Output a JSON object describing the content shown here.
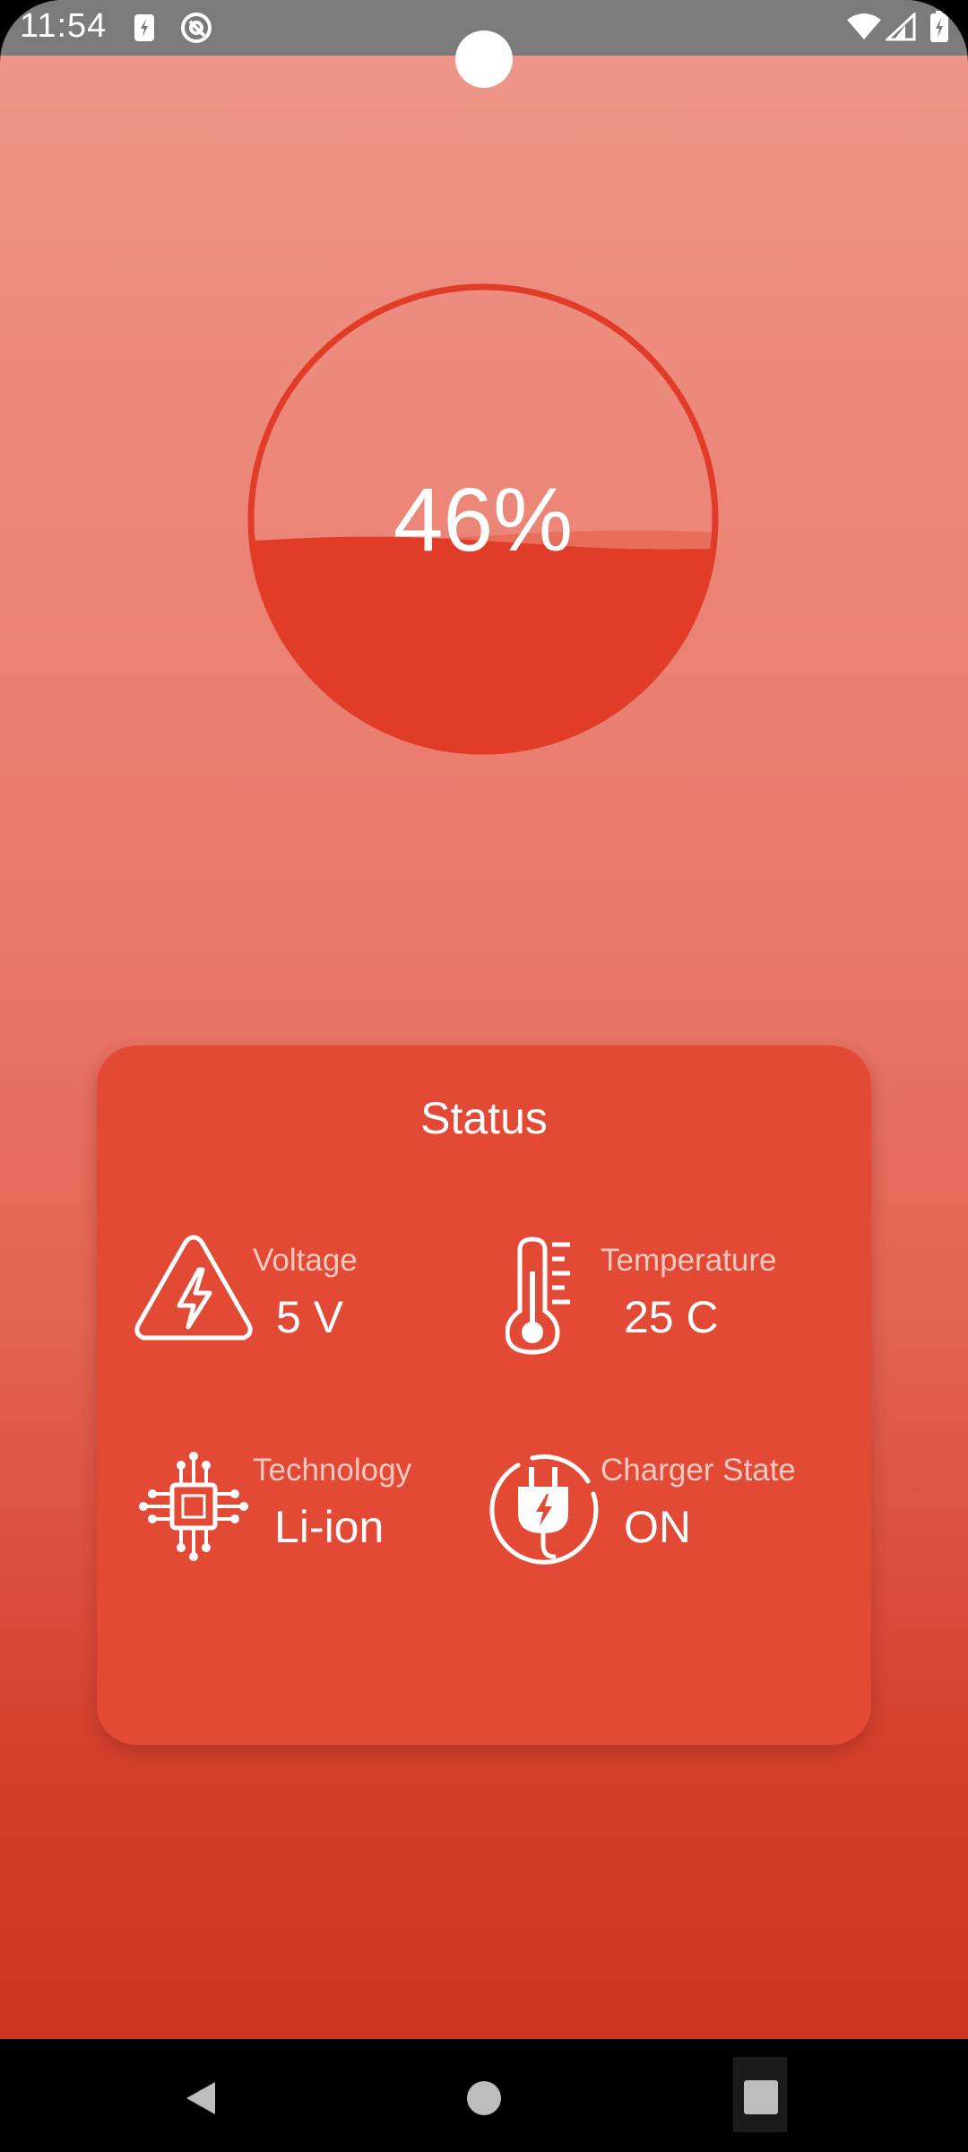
{
  "status_bar": {
    "time": "11:54"
  },
  "battery": {
    "percent_label": "46%",
    "level_fraction": 0.46,
    "fill_color": "#e03c28",
    "ring_color": "#e03c28"
  },
  "status_card": {
    "title": "Status",
    "items": [
      {
        "icon": "voltage-warning-icon",
        "label": "Voltage",
        "value": "5 V"
      },
      {
        "icon": "thermometer-icon",
        "label": "Temperature",
        "value": "25 C"
      },
      {
        "icon": "chip-icon",
        "label": "Technology",
        "value": "Li-ion"
      },
      {
        "icon": "charger-plug-icon",
        "label": "Charger State",
        "value": "ON"
      }
    ]
  },
  "nav_bar": {
    "buttons": [
      "back-icon",
      "home-icon",
      "recents-icon"
    ]
  }
}
